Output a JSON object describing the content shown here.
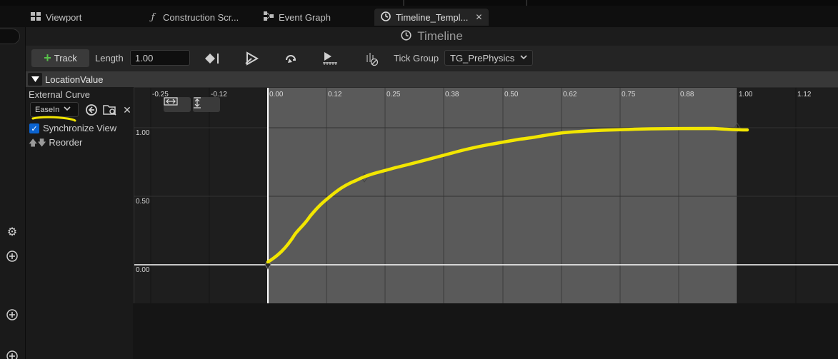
{
  "tabs": [
    {
      "icon": "viewport-icon",
      "label": "Viewport"
    },
    {
      "icon": "function-icon",
      "label": "Construction Scr..."
    },
    {
      "icon": "event-graph-icon",
      "label": "Event Graph"
    },
    {
      "icon": "clock-icon",
      "label": "Timeline_Templ...",
      "active": true
    }
  ],
  "header": {
    "title": "Timeline"
  },
  "toolbar": {
    "add_track_label": "Track",
    "length_label": "Length",
    "length_value": "1.00",
    "tick_group_label": "Tick Group",
    "tick_group_value": "TG_PrePhysics",
    "icons": [
      "add-key-icon",
      "use-last-keyframe-icon",
      "loop-icon",
      "replicated-icon",
      "ignore-time-dilation-icon"
    ]
  },
  "track": {
    "name": "LocationValue",
    "external_curve_label": "External Curve",
    "curve_value": "EaseIn",
    "synchronize_view_label": "Synchronize View",
    "synchronize_view_checked": true,
    "reorder_label": "Reorder"
  },
  "graph": {
    "x_ticks": [
      "-0.25",
      "-0.12",
      "0.00",
      "0.12",
      "0.25",
      "0.38",
      "0.50",
      "0.62",
      "0.75",
      "0.88",
      "1.00",
      "1.12"
    ],
    "y_ticks": [
      "1.00",
      "0.50",
      "0.00"
    ],
    "colors": {
      "curve_annotation": "#f2e600",
      "active_range": "#5a5a5a",
      "background": "#1e1e1e"
    }
  }
}
